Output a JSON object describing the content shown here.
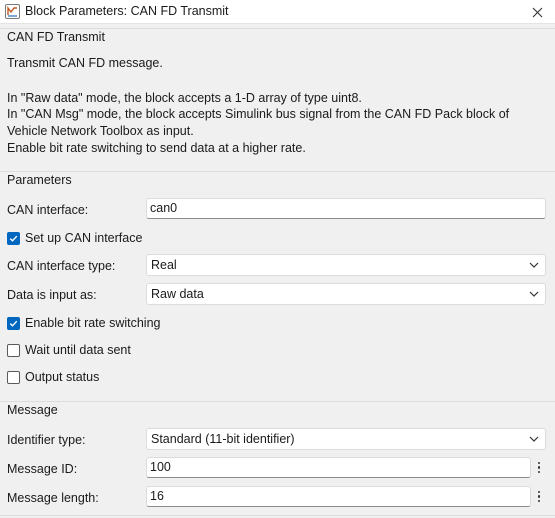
{
  "window": {
    "title": "Block Parameters: CAN FD Transmit"
  },
  "block": {
    "name": "CAN FD Transmit",
    "description": [
      "Transmit CAN FD message.",
      "",
      "In \"Raw data\" mode, the block accepts a 1-D array of type uint8.",
      "In \"CAN Msg\" mode, the block accepts Simulink bus signal from the CAN FD Pack block of",
      "Vehicle Network Toolbox as input.",
      "Enable bit rate switching to send data at a higher rate."
    ]
  },
  "parameters": {
    "header": "Parameters",
    "can_interface": {
      "label": "CAN interface:",
      "value": "can0"
    },
    "setup_can_interface": {
      "label": "Set up CAN interface",
      "checked": true
    },
    "can_interface_type": {
      "label": "CAN interface type:",
      "selected": "Real"
    },
    "data_input": {
      "label": "Data is input as:",
      "selected": "Raw data"
    },
    "bit_rate_switching": {
      "label": "Enable bit rate switching",
      "checked": true
    },
    "wait_until_sent": {
      "label": "Wait until data sent",
      "checked": false
    },
    "output_status": {
      "label": "Output status",
      "checked": false
    }
  },
  "message": {
    "header": "Message",
    "identifier_type": {
      "label": "Identifier type:",
      "selected": "Standard (11-bit identifier)"
    },
    "message_id": {
      "label": "Message ID:",
      "value": "100"
    },
    "message_length": {
      "label": "Message length:",
      "value": "16"
    }
  },
  "colors": {
    "accent": "#0067c0",
    "background": "#f0f0f0",
    "field_background": "#ffffff"
  },
  "icons": {
    "app": "simulink-block-icon",
    "close": "close-icon",
    "checkbox": "checkmark-icon",
    "dropdown": "chevron-down-icon",
    "more": "kebab-menu-icon"
  }
}
